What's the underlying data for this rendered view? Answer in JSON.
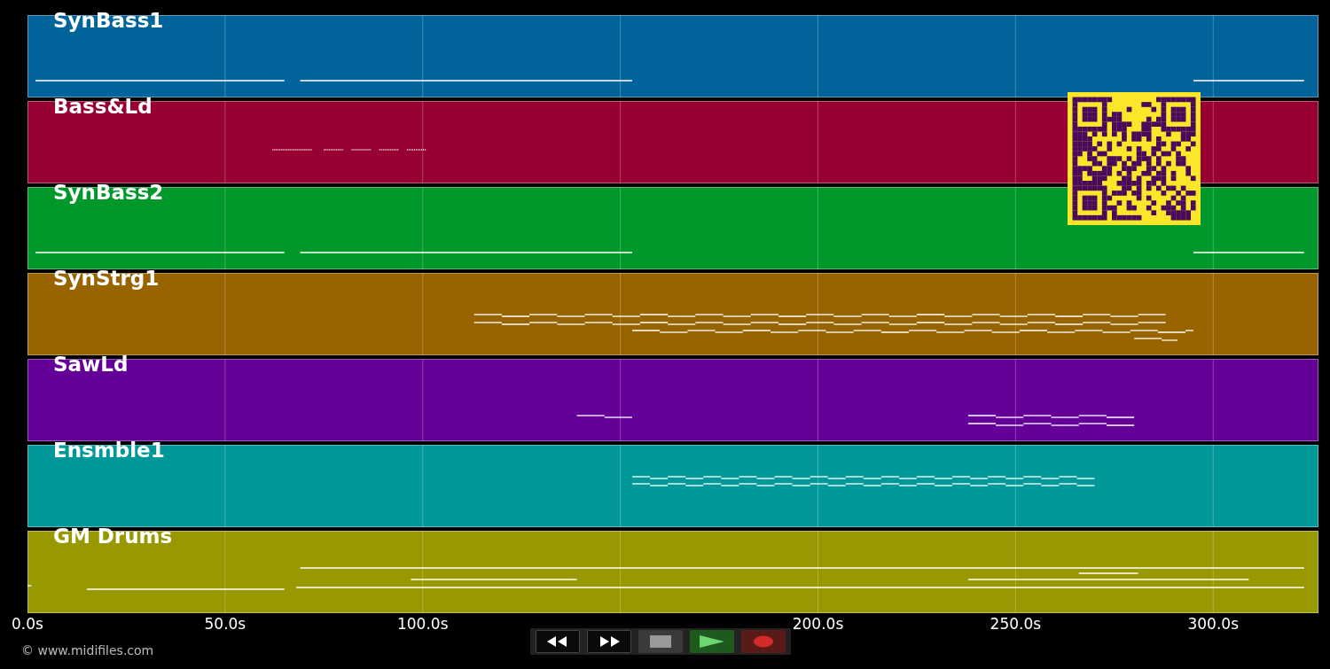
{
  "tracks": [
    {
      "name": "SynBass1",
      "color": "#00649a"
    },
    {
      "name": "Bass&Ld",
      "color": "#980032"
    },
    {
      "name": "SynBass2",
      "color": "#00982a"
    },
    {
      "name": "SynStrg1",
      "color": "#986400"
    },
    {
      "name": "SawLd",
      "color": "#640098"
    },
    {
      "name": "Ensmble1",
      "color": "#009898"
    },
    {
      "name": "GM Drums",
      "color": "#989800"
    }
  ],
  "time_axis": {
    "ticks": [
      "0.0s",
      "50.0s",
      "100.0s",
      "200.0s",
      "250.0s",
      "300.0s"
    ]
  },
  "transport": [
    {
      "kind": "rewind"
    },
    {
      "kind": "fast-forward"
    },
    {
      "kind": "stop"
    },
    {
      "kind": "play"
    },
    {
      "kind": "record"
    }
  ],
  "copyright": "© www.midifiles.com"
}
